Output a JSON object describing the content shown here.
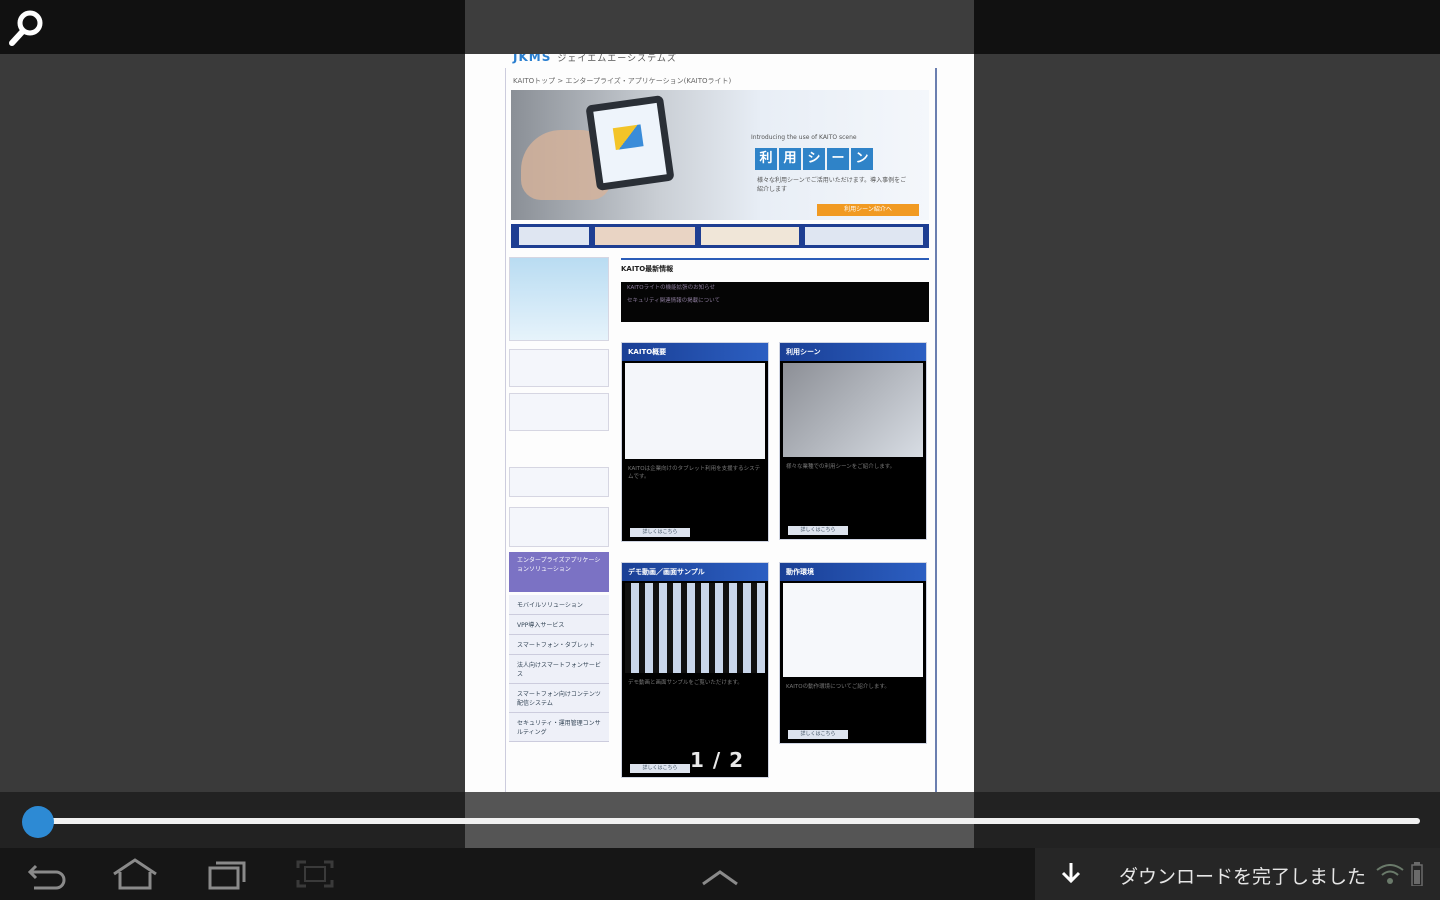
{
  "page_preview": {
    "logo": "JKMS",
    "logo_sub": "ジェイエムエーシステムズ",
    "breadcrumb": "KAITOトップ > エンタープライズ・アプリケーション(KAITOライト)",
    "hero": {
      "caption": "Introducing the use of KAITO scene",
      "tiles": [
        "利",
        "用",
        "シ",
        "ー",
        "ン"
      ],
      "desc": "様々な利用シーンでご活用いただけます。導入事例をご紹介します",
      "more": "利用シーン紹介へ"
    },
    "sidebar_nav": "エンタープライズアプリケーションソリューション",
    "sidebar_items": [
      "モバイルソリューション",
      "VPP導入サービス",
      "スマートフォン・タブレット",
      "法人向けスマートフォンサービス",
      "スマートフォン向けコンテンツ配信システム",
      "セキュリティ・運用管理コンサルティング"
    ],
    "news_title": "KAITO最新情報",
    "news_items": [
      "KAITOライトの機能拡張のお知らせ",
      "セキュリティ関連情報の掲載について"
    ],
    "cards": [
      {
        "title": "KAITO概要",
        "text": "KAITOは企業向けのタブレット利用を支援するシステムです。",
        "button": "詳しくはこちら"
      },
      {
        "title": "利用シーン",
        "text": "様々な業種での利用シーンをご紹介します。",
        "button": "詳しくはこちら"
      },
      {
        "title": "デモ動画／画面サンプル",
        "text": "デモ動画と画面サンプルをご覧いただけます。",
        "button": "詳しくはこちら"
      },
      {
        "title": "動作環境",
        "text": "KAITOの動作環境についてご紹介します。",
        "button": "詳しくはこちら"
      }
    ],
    "page_counter": "1 / 2"
  },
  "slider": {
    "position_fraction": 0.01
  },
  "notification": {
    "message": "ダウンロードを完了しました"
  },
  "icons": {
    "search": "search-icon",
    "back": "back-icon",
    "home": "home-icon",
    "recent": "recent-apps-icon",
    "screenshot": "screenshot-icon",
    "up": "chevron-up-icon",
    "download": "download-icon",
    "signal": "signal-icon",
    "battery": "battery-icon"
  },
  "colors": {
    "accent": "#2d8ad4",
    "card_header": "#1a3f95",
    "sidebar_nav": "#7b72c4"
  }
}
